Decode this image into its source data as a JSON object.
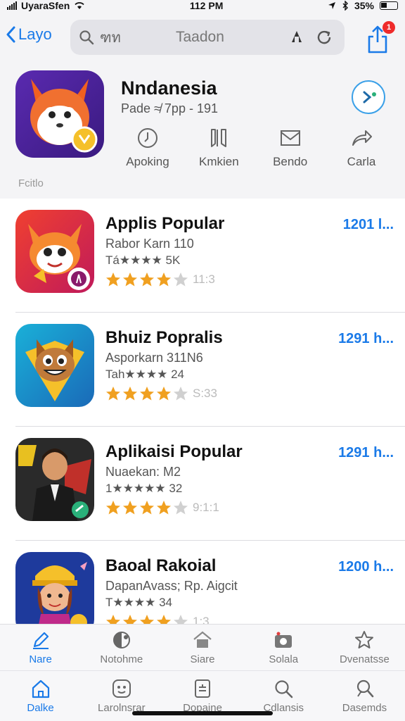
{
  "status": {
    "carrier": "UyaraSfen",
    "time": "112 PM",
    "battery": "35%"
  },
  "nav": {
    "back_label": "Layo",
    "search_query": "ฑท",
    "search_center": "Taadon",
    "badge": "1"
  },
  "featured": {
    "title": "Nndanesia",
    "subtitle": "Pade ≉ 7pp - 191",
    "actions": [
      {
        "label": "Apoking",
        "icon": "clock-icon"
      },
      {
        "label": "Kmkien",
        "icon": "bookmark-icon"
      },
      {
        "label": "Bendo",
        "icon": "mail-icon"
      },
      {
        "label": "Carla",
        "icon": "share-arrow-icon"
      }
    ],
    "section_hint": "Fcitlo"
  },
  "apps": [
    {
      "title": "Applis Popular",
      "line1": "Rabor Karn 110",
      "line2": "Tá★★★★ 5K",
      "rating": 4,
      "rating_text": "11:3",
      "action": "1201 l...",
      "icon_bg": "#e8402a"
    },
    {
      "title": "Bhuiz Popralis",
      "line1": "Asporkarn 311N6",
      "line2": "Tah★★★★ 24",
      "rating": 4,
      "rating_text": "S:33",
      "action": "1291 h...",
      "icon_bg": "#2a9ed8"
    },
    {
      "title": "Aplikaisi Popular",
      "line1": "Nuaekan: M2",
      "line2": "1★★★★★ 32",
      "rating": 4,
      "rating_text": "9:1:1",
      "action": "1291 h...",
      "icon_bg": "#2a2a2a"
    },
    {
      "title": "Baoal Rakoial",
      "line1": "DapanAvass; Rp. Aigcit",
      "line2": "T★★★★ 34",
      "rating": 4,
      "rating_text": "1:3",
      "action": "1200 h...",
      "icon_bg": "#1e3a9c"
    }
  ],
  "tabbar1": [
    {
      "label": "Nare",
      "icon": "pencil-icon",
      "active": true
    },
    {
      "label": "Notohme",
      "icon": "globe-icon",
      "active": false
    },
    {
      "label": "Siare",
      "icon": "house-icon",
      "active": false
    },
    {
      "label": "Solala",
      "icon": "camera-icon",
      "active": false
    },
    {
      "label": "Dvenatsse",
      "icon": "star-outline-icon",
      "active": false
    }
  ],
  "tabbar2": [
    {
      "label": "Dalke",
      "icon": "home-icon",
      "active": true
    },
    {
      "label": "Larolnsrar",
      "icon": "face-icon",
      "active": false
    },
    {
      "label": "Dopaine",
      "icon": "document-icon",
      "active": false
    },
    {
      "label": "Cdlansis",
      "icon": "search-icon",
      "active": false
    },
    {
      "label": "Dasemds",
      "icon": "search-person-icon",
      "active": false
    }
  ],
  "colors": {
    "accent": "#1a7ae8",
    "star": "#f0a020",
    "star_empty": "#d0d0d0"
  }
}
